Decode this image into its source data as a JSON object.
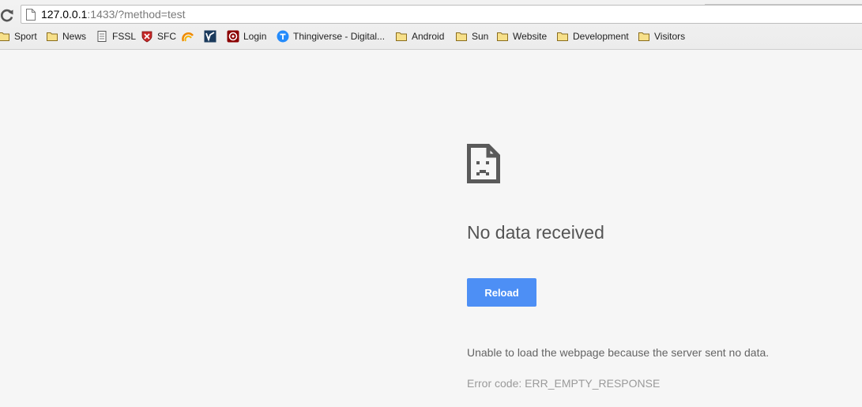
{
  "browser": {
    "url_host": "127.0.0.1",
    "url_rest": ":1433/?method=test",
    "bookmarks": [
      {
        "label": "Sport",
        "icon": "folder-icon"
      },
      {
        "label": "News",
        "icon": "folder-icon"
      },
      {
        "label": "FSSL",
        "icon": "document-icon"
      },
      {
        "label": "SFC",
        "icon": "shield-icon"
      },
      {
        "label": "",
        "icon": "sun-logo-icon"
      },
      {
        "label": "",
        "icon": "logo-icon"
      },
      {
        "label": "Login",
        "icon": "target-icon"
      },
      {
        "label": "Thingiverse - Digital...",
        "icon": "thingiverse-icon"
      },
      {
        "label": "Android",
        "icon": "folder-icon"
      },
      {
        "label": "Sun",
        "icon": "folder-icon"
      },
      {
        "label": "Website",
        "icon": "folder-icon"
      },
      {
        "label": "Development",
        "icon": "folder-icon"
      },
      {
        "label": "Visitors",
        "icon": "folder-icon"
      }
    ]
  },
  "error": {
    "icon": "sad-page-icon",
    "title": "No data received",
    "reload_label": "Reload",
    "description": "Unable to load the webpage because the server sent no data.",
    "code": "Error code: ERR_EMPTY_RESPONSE"
  },
  "colors": {
    "background": "#f6f6f6",
    "button": "#4d8ff5",
    "title": "#555555"
  }
}
